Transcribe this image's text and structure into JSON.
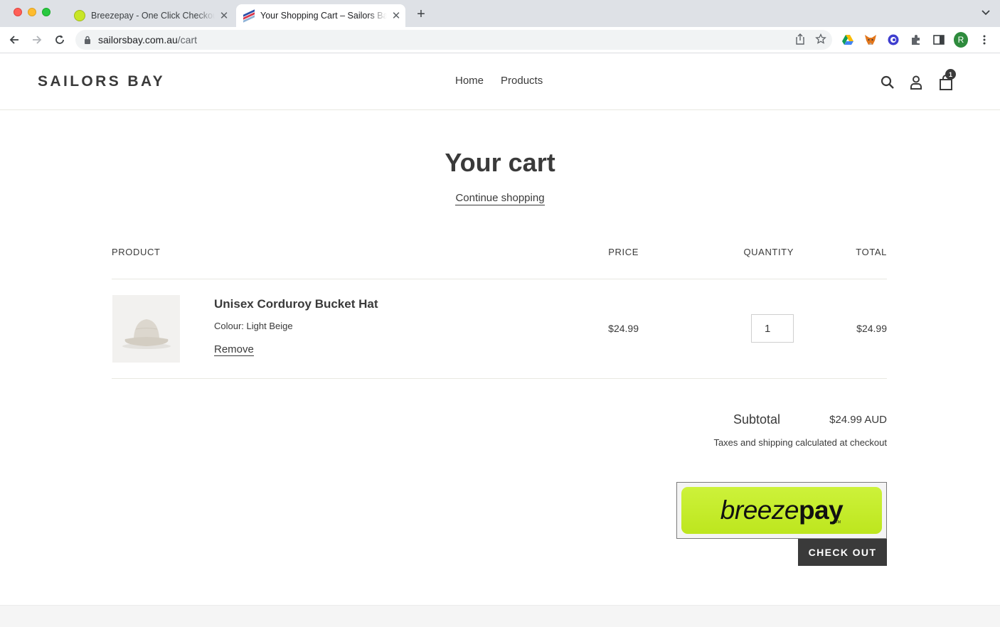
{
  "browser": {
    "tabs": [
      {
        "title": "Breezepay - One Click Checkout",
        "active": false
      },
      {
        "title": "Your Shopping Cart – Sailors Bay",
        "active": true
      }
    ],
    "url_host": "sailorsbay.com.au",
    "url_path": "/cart",
    "profile_initial": "R"
  },
  "header": {
    "logo": "SAILORS BAY",
    "nav": [
      "Home",
      "Products"
    ],
    "cart_count": "1"
  },
  "cart": {
    "title": "Your cart",
    "continue_link": "Continue shopping",
    "columns": {
      "product": "PRODUCT",
      "price": "PRICE",
      "quantity": "QUANTITY",
      "total": "TOTAL"
    },
    "items": [
      {
        "name": "Unisex Corduroy Bucket Hat",
        "variant": "Colour: Light Beige",
        "remove_label": "Remove",
        "price": "$24.99",
        "quantity": "1",
        "line_total": "$24.99"
      }
    ],
    "subtotal_label": "Subtotal",
    "subtotal_value": "$24.99 AUD",
    "tax_note": "Taxes and shipping calculated at checkout",
    "breezepay": {
      "part1": "breeze",
      "part2": "pay",
      "tm": "TM"
    },
    "checkout_label": "CHECK OUT"
  },
  "colors": {
    "text": "#3a3a3a",
    "breezepay_green": "#c6ec2c",
    "button_dark": "#3a3a3a"
  }
}
